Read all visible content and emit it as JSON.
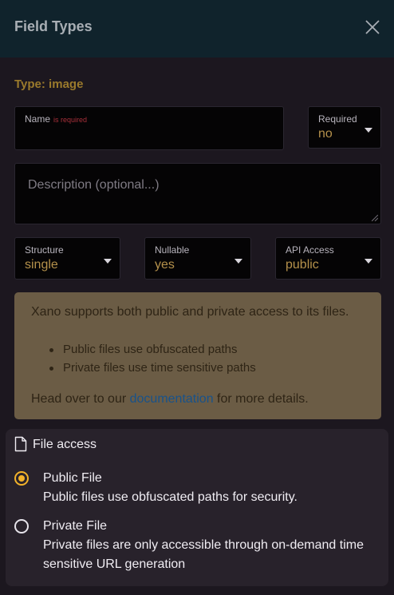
{
  "header": {
    "title": "Field Types"
  },
  "type_title": "Type: image",
  "name_field": {
    "label": "Name",
    "required_note": "is required",
    "value": ""
  },
  "required_select": {
    "label": "Required",
    "value": "no"
  },
  "description_field": {
    "placeholder": "Description (optional...)"
  },
  "structure_select": {
    "label": "Structure",
    "value": "single"
  },
  "nullable_select": {
    "label": "Nullable",
    "value": "yes"
  },
  "api_access_select": {
    "label": "API Access",
    "value": "public"
  },
  "info": {
    "intro": "Xano supports both public and private access to its files.",
    "bullets": [
      "Public files use obfuscated paths",
      "Private files use time sensitive paths"
    ],
    "footer_prefix": "Head over to our ",
    "footer_link": "documentation",
    "footer_suffix": " for more details."
  },
  "file_access": {
    "title": "File access",
    "selected": "public",
    "options": [
      {
        "title": "Public File",
        "desc": "Public files use obfuscated paths for security."
      },
      {
        "title": "Private File",
        "desc": "Private files are only accessible through on-demand time sensitive URL generation"
      }
    ]
  },
  "colors": {
    "accent": "#f2b22a",
    "header_bg": "#10232c",
    "info_bg": "#6b5c45",
    "link": "#18528a",
    "error": "#a8303a"
  }
}
